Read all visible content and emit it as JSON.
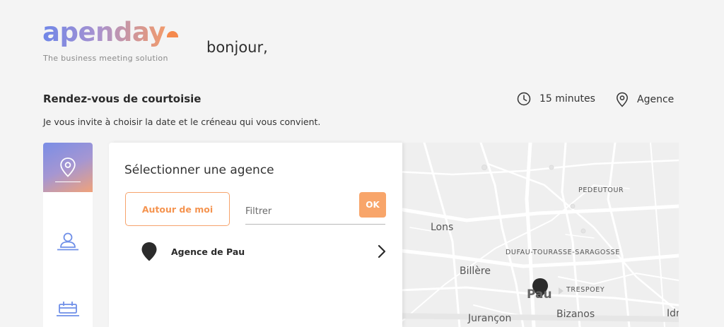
{
  "brand": {
    "logo_text": "apenday",
    "tagline": "The business meeting solution"
  },
  "greeting": "bonjour,",
  "meeting": {
    "title": "Rendez-vous de courtoisie",
    "subtitle": "Je vous invite à choisir la date et le créneau qui vous convient.",
    "duration": "15 minutes",
    "location": "Agence"
  },
  "steps": [
    {
      "icon": "location-pin-icon",
      "active": true
    },
    {
      "icon": "user-icon",
      "active": false
    },
    {
      "icon": "calendar-icon",
      "active": false
    }
  ],
  "panel": {
    "title": "Sélectionner une agence",
    "around_me_label": "Autour de moi",
    "filter_placeholder": "Filtrer",
    "filter_value": "",
    "ok_label": "OK",
    "agencies": [
      {
        "name": "Agence de Pau"
      }
    ]
  },
  "map": {
    "labels": {
      "pedeutour": "PEDEUTOUR",
      "lons": "Lons",
      "dufau": "DUFAU-TOURASSE-SARAGOSSE",
      "billere": "Billère",
      "trespoey": "TRESPOEY",
      "pau": "Pau",
      "bizanos": "Bizanos",
      "jurancon": "Jurançon",
      "idron": "Idr"
    }
  },
  "colors": {
    "accent_orange": "#f59450",
    "accent_blue": "#7a8ee6",
    "background": "#f4f4f4"
  }
}
